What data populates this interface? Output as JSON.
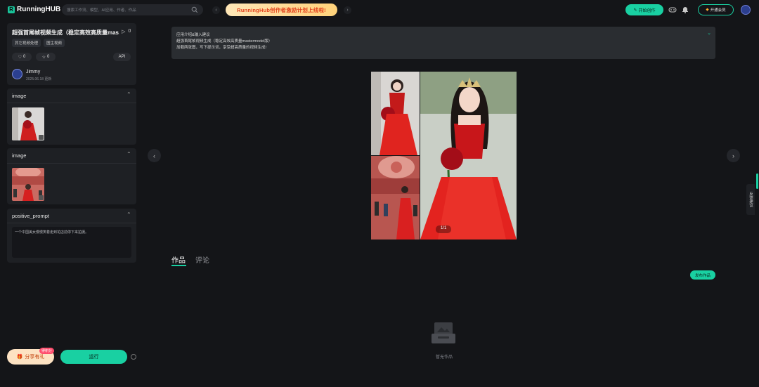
{
  "header": {
    "logo_mark": "R",
    "logo_text": "RunningHUB",
    "search_placeholder": "搜索工作流、模型、AI应用、作者、作品",
    "banner_text": "RunningHub创作者激励计划上线啦!",
    "create_label": "开始创作",
    "member_label": "开通会员"
  },
  "app": {
    "title": "超强首尾帧视频生成（稳定高效高质量mas…",
    "run_count": "0",
    "tags": [
      "其它视频处理",
      "图生视频"
    ],
    "likes": "0",
    "stars": "0",
    "api_label": "API",
    "author": "Jimmy",
    "updated": "2025.06.18 更新"
  },
  "inputs": {
    "image1_label": "image",
    "image2_label": "image",
    "prompt_label": "positive_prompt",
    "prompt_value": "一个中国美女慢慢笑着走到花店前停下来拍摄。"
  },
  "actions": {
    "share_label": "分享有礼",
    "share_badge": "得积分",
    "run_label": "运行"
  },
  "intro": {
    "heading": "应用介绍&输入建议",
    "line1": "超强首尾帧视频生成（稳定高效高质量mastermodel版）",
    "line2": "加载两张图，写下提示词，享受超高质量的视频生成!"
  },
  "gallery": {
    "page": "1/1"
  },
  "tabs": {
    "works": "作品",
    "comments": "评论"
  },
  "publish_label": "发布作品",
  "empty_text": "暂无作品",
  "side_tab": "反馈建议",
  "colors": {
    "accent": "#19d0a2",
    "bg": "#141518",
    "card": "#1e2024",
    "dress_red": "#d8201f"
  }
}
